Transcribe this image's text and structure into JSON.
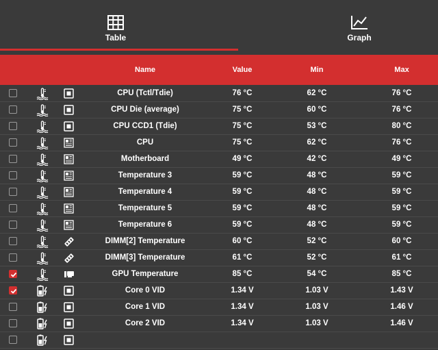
{
  "tabs": [
    {
      "label": "Table",
      "icon": "table-icon",
      "active": true
    },
    {
      "label": "Graph",
      "icon": "graph-icon",
      "active": false
    }
  ],
  "columns": {
    "name": "Name",
    "value": "Value",
    "min": "Min",
    "max": "Max"
  },
  "colors": {
    "accent": "#d32f2f",
    "background": "#3a3a3a",
    "divider": "#4a4a4a",
    "text": "#ffffff"
  },
  "rows": [
    {
      "checked": false,
      "type": "temperature",
      "device": "cpu-chip",
      "name": "CPU (Tctl/Tdie)",
      "value": "76 °C",
      "min": "62 °C",
      "max": "76 °C"
    },
    {
      "checked": false,
      "type": "temperature",
      "device": "cpu-chip",
      "name": "CPU Die (average)",
      "value": "75 °C",
      "min": "60 °C",
      "max": "76 °C"
    },
    {
      "checked": false,
      "type": "temperature",
      "device": "cpu-chip",
      "name": "CPU CCD1 (Tdie)",
      "value": "75 °C",
      "min": "53 °C",
      "max": "80 °C"
    },
    {
      "checked": false,
      "type": "temperature",
      "device": "motherboard",
      "name": "CPU",
      "value": "75 °C",
      "min": "62 °C",
      "max": "76 °C"
    },
    {
      "checked": false,
      "type": "temperature",
      "device": "motherboard",
      "name": "Motherboard",
      "value": "49 °C",
      "min": "42 °C",
      "max": "49 °C"
    },
    {
      "checked": false,
      "type": "temperature",
      "device": "motherboard",
      "name": "Temperature 3",
      "value": "59 °C",
      "min": "48 °C",
      "max": "59 °C"
    },
    {
      "checked": false,
      "type": "temperature",
      "device": "motherboard",
      "name": "Temperature 4",
      "value": "59 °C",
      "min": "48 °C",
      "max": "59 °C"
    },
    {
      "checked": false,
      "type": "temperature",
      "device": "motherboard",
      "name": "Temperature 5",
      "value": "59 °C",
      "min": "48 °C",
      "max": "59 °C"
    },
    {
      "checked": false,
      "type": "temperature",
      "device": "motherboard",
      "name": "Temperature 6",
      "value": "59 °C",
      "min": "48 °C",
      "max": "59 °C"
    },
    {
      "checked": false,
      "type": "temperature",
      "device": "memory",
      "name": "DIMM[2] Temperature",
      "value": "60 °C",
      "min": "52 °C",
      "max": "60 °C"
    },
    {
      "checked": false,
      "type": "temperature",
      "device": "memory",
      "name": "DIMM[3] Temperature",
      "value": "61 °C",
      "min": "52 °C",
      "max": "61 °C"
    },
    {
      "checked": true,
      "type": "temperature",
      "device": "gpu",
      "name": "GPU Temperature",
      "value": "85 °C",
      "min": "54 °C",
      "max": "85 °C"
    },
    {
      "checked": true,
      "type": "voltage",
      "device": "cpu-chip",
      "name": "Core 0 VID",
      "value": "1.34 V",
      "min": "1.03 V",
      "max": "1.43 V"
    },
    {
      "checked": false,
      "type": "voltage",
      "device": "cpu-chip",
      "name": "Core 1 VID",
      "value": "1.34 V",
      "min": "1.03 V",
      "max": "1.46 V"
    },
    {
      "checked": false,
      "type": "voltage",
      "device": "cpu-chip",
      "name": "Core 2 VID",
      "value": "1.34 V",
      "min": "1.03 V",
      "max": "1.46 V"
    },
    {
      "checked": false,
      "type": "voltage",
      "device": "cpu-chip",
      "name": "",
      "value": "",
      "min": "",
      "max": ""
    }
  ]
}
